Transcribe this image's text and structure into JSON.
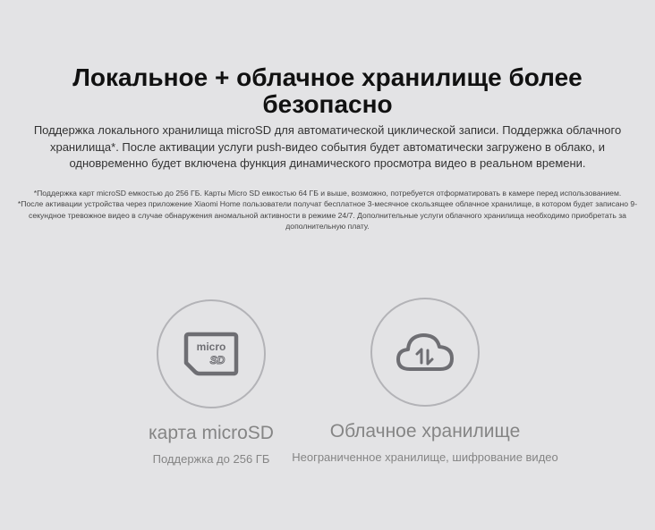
{
  "heading": "Локальное + облачное хранилище более безопасно",
  "lead": "Поддержка локального хранилища microSD для автоматической циклической записи. Поддержка облачного хранилища*. После активации услуги push-видео события будет автоматически загружено в облако, и одновременно будет включена функция динамического просмотра видео в реальном времени.",
  "footnotes": [
    "*Поддержка карт microSD емкостью до 256 ГБ. Карты Micro SD емкостью 64 ГБ и выше, возможно, потребуется отформатировать в камере перед использованием.",
    "*После активации устройства через приложение Xiaomi Home пользователи получат бесплатное 3-месячное скользящее облачное хранилище, в котором будет записано 9-секундное тревожное видео в случае обнаружения аномальной активности в режиме 24/7. Дополнительные услуги облачного хранилища необходимо приобретать за дополнительную плату."
  ],
  "features": [
    {
      "icon": "microsd-card-icon",
      "icon_text_top": "micro",
      "icon_text_bottom": "SD",
      "label": "карта microSD",
      "desc": "Поддержка до 256 ГБ"
    },
    {
      "icon": "cloud-sync-icon",
      "label": "Облачное хранилище",
      "desc": "Неограниченное хранилище, шифрование видео"
    }
  ],
  "colors": {
    "background": "#e3e3e5",
    "icon": "#6e6e73",
    "circle_border": "#b3b3b7",
    "muted_text": "#858585"
  }
}
